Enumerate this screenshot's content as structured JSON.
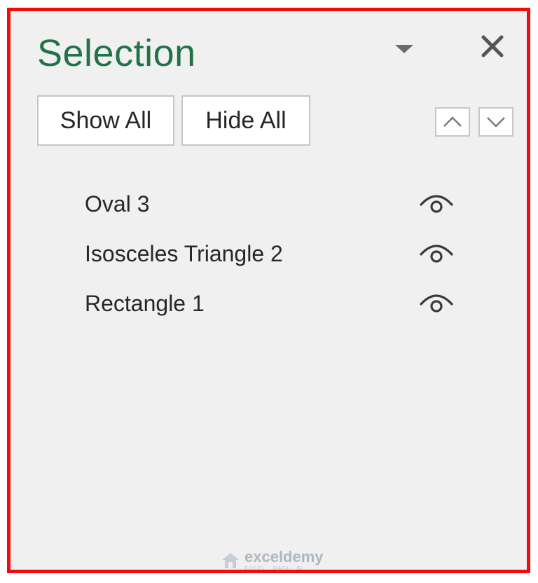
{
  "pane": {
    "title": "Selection",
    "menu_icon": "triangle-down-icon",
    "close_icon": "close-icon"
  },
  "toolbar": {
    "show_all_label": "Show All",
    "hide_all_label": "Hide All",
    "bring_forward_icon": "chevron-up-icon",
    "send_backward_icon": "chevron-down-icon"
  },
  "objects": [
    {
      "name": "Oval 3",
      "visible": true,
      "icon": "eye-icon"
    },
    {
      "name": "Isosceles Triangle 2",
      "visible": true,
      "icon": "eye-icon"
    },
    {
      "name": "Rectangle 1",
      "visible": true,
      "icon": "eye-icon"
    }
  ],
  "watermark": {
    "name": "exceldemy",
    "tagline": "EXCEL · DATA · BI"
  },
  "colors": {
    "title": "#217346",
    "highlight_border": "#f20d0d",
    "pane_background": "#f0f0f0"
  }
}
